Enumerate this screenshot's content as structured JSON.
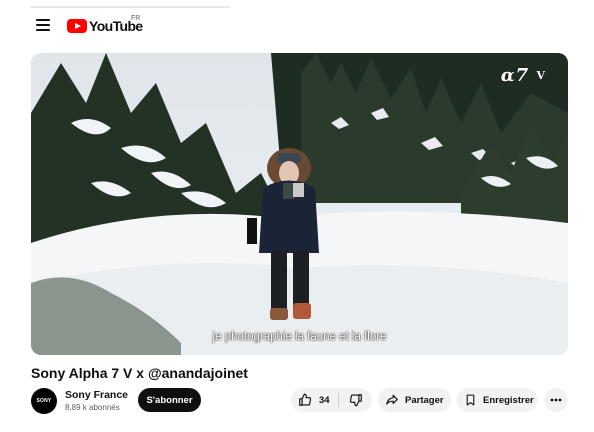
{
  "header": {
    "logo_text": "YouTube",
    "country_code": "FR"
  },
  "player": {
    "brand_mark": "α7",
    "brand_mark_suffix": "V",
    "caption": "je photographie la faune et la flore"
  },
  "video": {
    "title": "Sony Alpha 7 V x @anandajoinet"
  },
  "channel": {
    "avatar_text": "SONY",
    "name": "Sony France",
    "subscribers": "8,89 k abonnés",
    "subscribe_label": "S'abonner"
  },
  "actions": {
    "like_count": "34",
    "share_label": "Partager",
    "save_label": "Enregistrer"
  },
  "icons": {
    "menu": "menu-icon",
    "like": "thumbs-up-icon",
    "dislike": "thumbs-down-icon",
    "share": "share-arrow-icon",
    "save": "bookmark-icon",
    "more": "more-horizontal-icon"
  },
  "colors": {
    "brand_red": "#ff0000",
    "subscribe_bg": "#0f0f0f",
    "pill_bg": "#f2f2f2",
    "secondary_text": "#606060"
  }
}
